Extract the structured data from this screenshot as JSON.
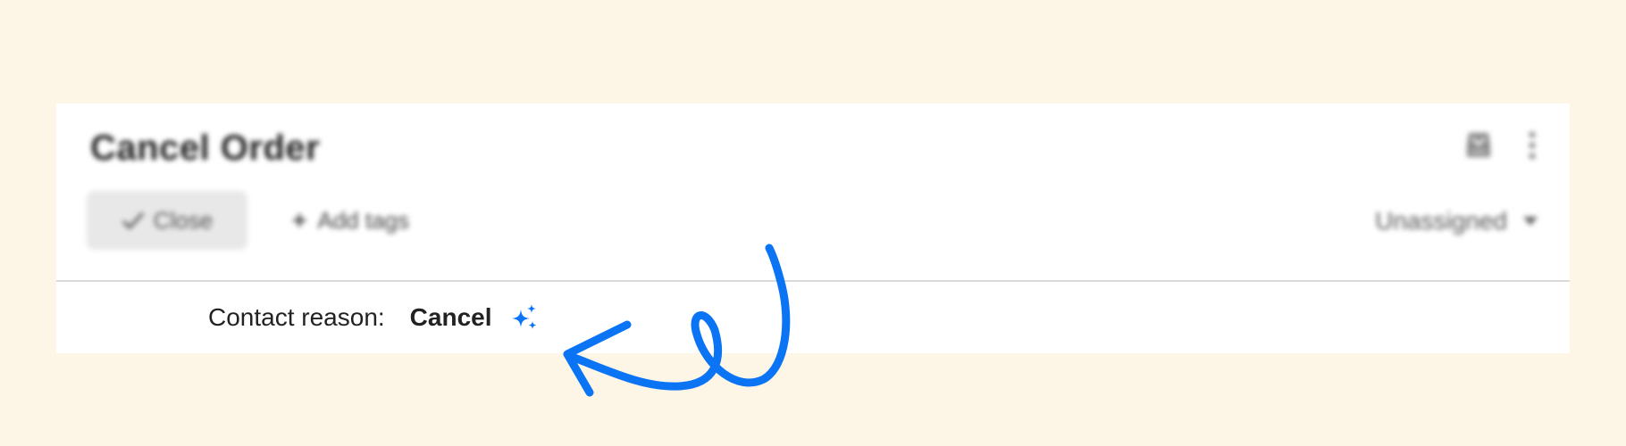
{
  "ticket": {
    "title": "Cancel Order"
  },
  "toolbar": {
    "close_label": "Close",
    "add_tags_label": "Add tags",
    "add_tags_icon": "plus-icon",
    "assignee_label": "Unassigned"
  },
  "header_icons": [
    "inbox-icon",
    "kebab-menu-icon"
  ],
  "contact_reason": {
    "label": "Contact reason:",
    "value": "Cancel",
    "icon": "sparkle-icon"
  },
  "colors": {
    "page_background": "#fdf5e6",
    "card_background": "#ffffff",
    "accent": "#0a74f5"
  }
}
